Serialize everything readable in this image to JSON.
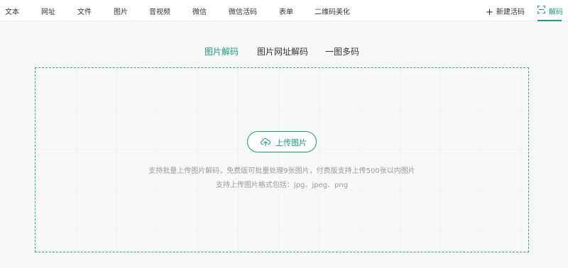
{
  "nav": {
    "items": [
      "文本",
      "网址",
      "文件",
      "图片",
      "音视频",
      "微信",
      "微信活码",
      "表单",
      "二维码美化"
    ],
    "new_code_label": "新建活码",
    "decode_label": "解码",
    "plus_icon": "plus-icon",
    "decode_icon": "scan-icon"
  },
  "tabs": {
    "items": [
      "图片解码",
      "图片网址解码",
      "一图多码"
    ],
    "active": "图片解码"
  },
  "upload": {
    "button_label": "上传图片",
    "icon": "cloud-upload-icon",
    "hint_line1": "支持批量上传图片解码，免费版可批量处理9张图片，付费版支持上传500张以内图片",
    "hint_line2": "支持上传图片格式包括：jpg、jpeg、png"
  },
  "colors": {
    "accent": "#17a07e",
    "hint_text": "#999999",
    "background": "#f6f7f7"
  }
}
